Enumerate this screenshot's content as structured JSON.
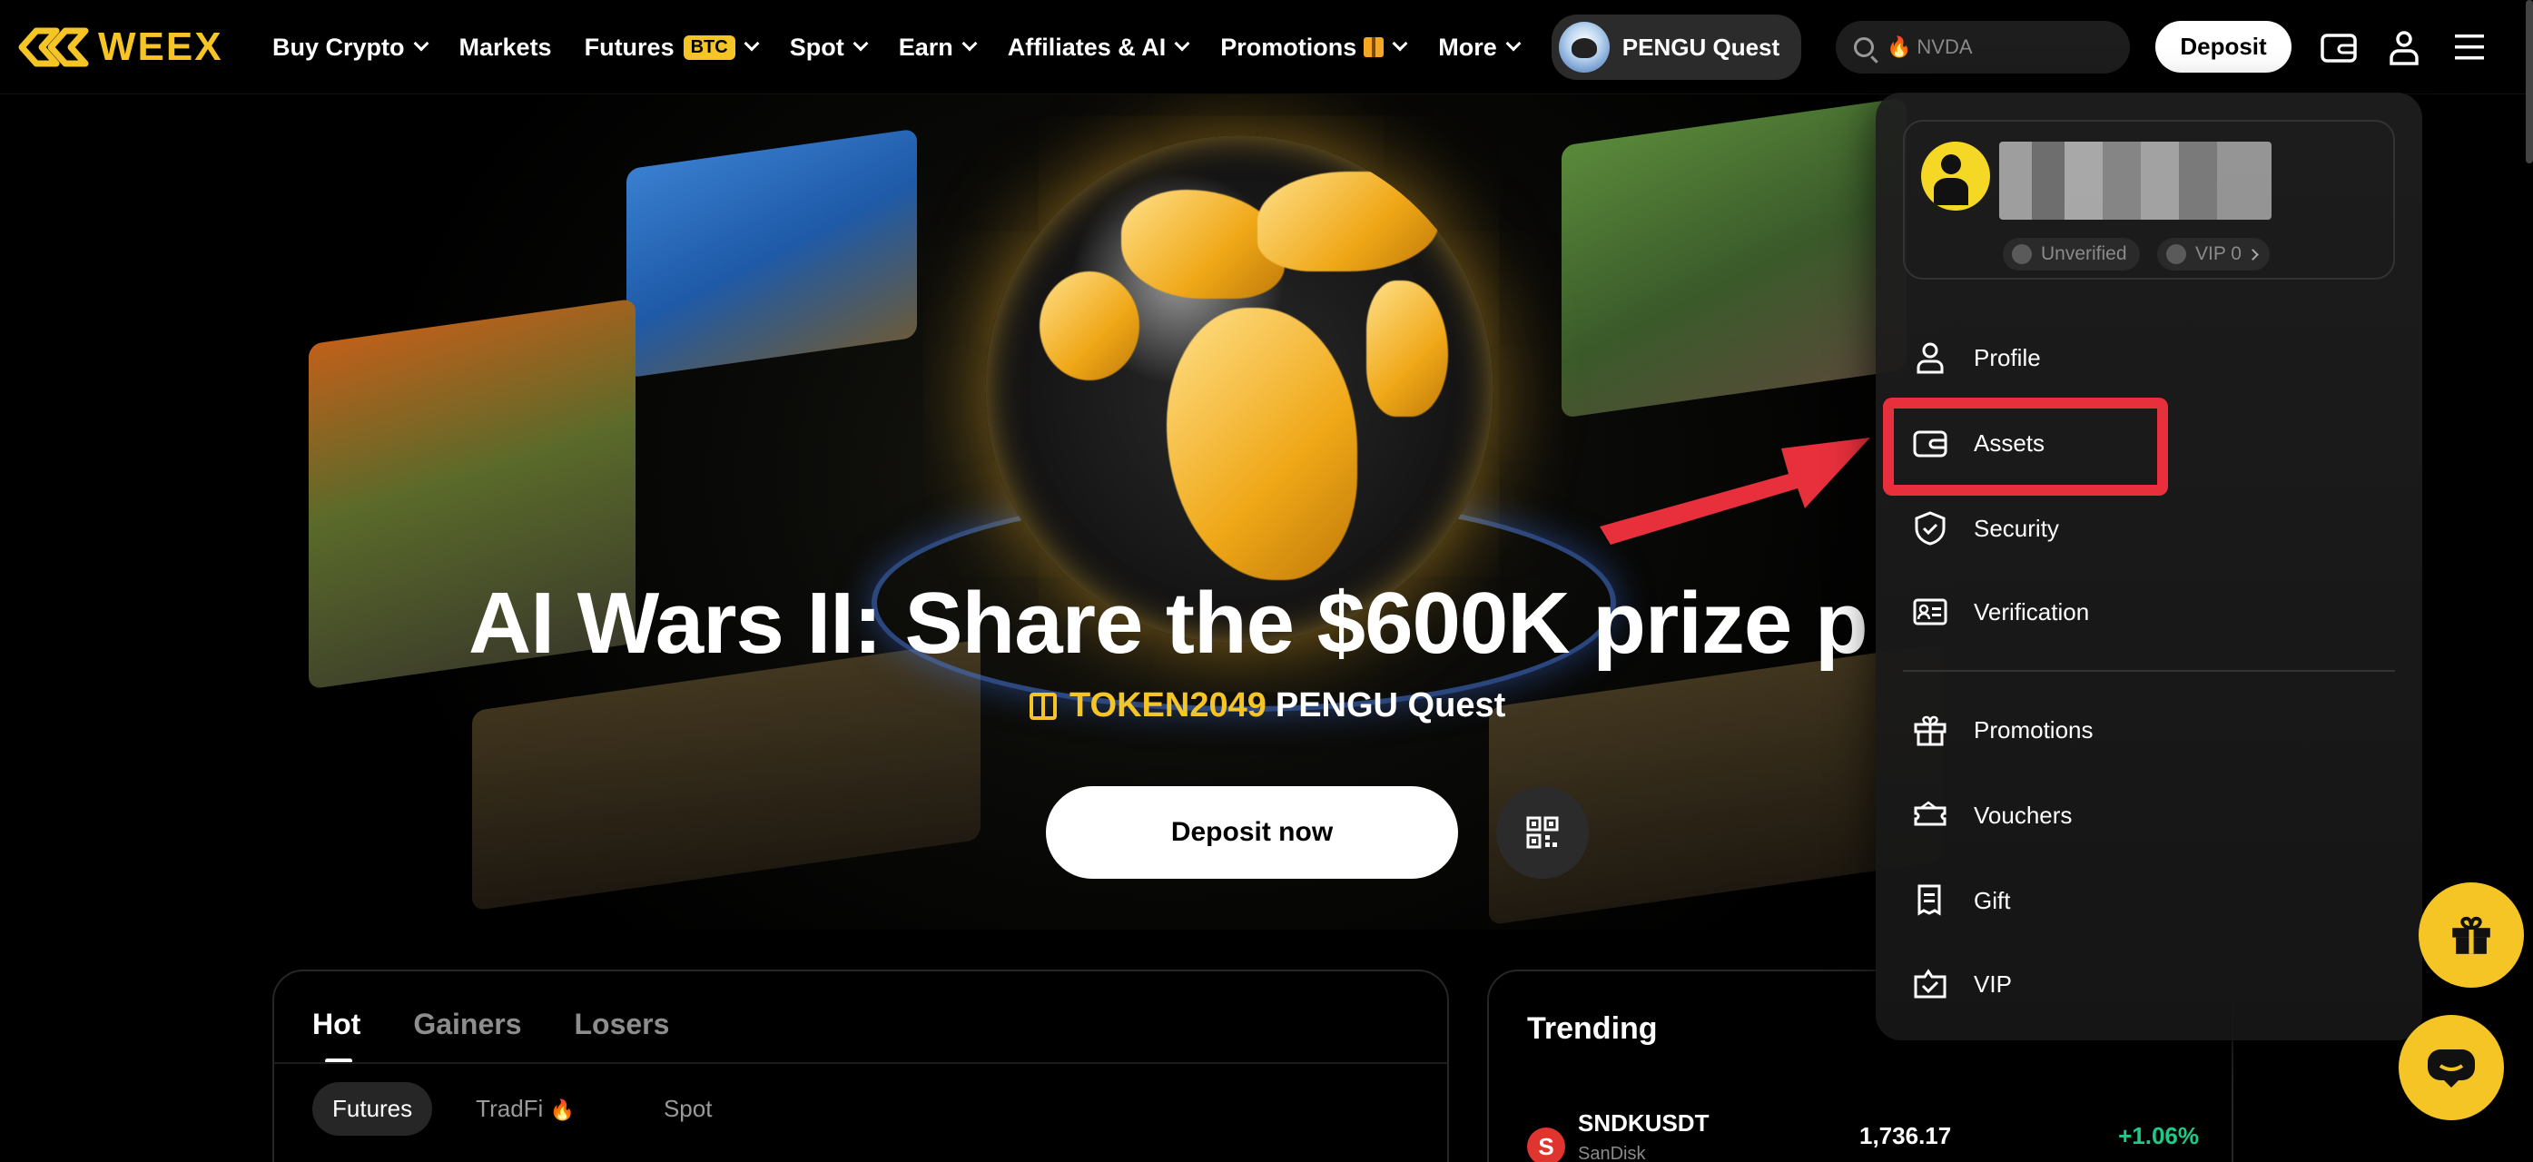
{
  "brand": {
    "name": "WEEX",
    "color": "#f5c526"
  },
  "nav": {
    "items": [
      {
        "label": "Buy Crypto",
        "dropdown": true
      },
      {
        "label": "Markets",
        "dropdown": false
      },
      {
        "label": "Futures",
        "badge": "BTC",
        "dropdown": true
      },
      {
        "label": "Spot",
        "dropdown": true
      },
      {
        "label": "Earn",
        "dropdown": true
      },
      {
        "label": "Affiliates & AI",
        "dropdown": true
      },
      {
        "label": "Promotions",
        "dropdown": true
      },
      {
        "label": "More",
        "dropdown": true
      }
    ],
    "quest": "PENGU Quest",
    "search_placeholder": "NVDA",
    "deposit": "Deposit",
    "icons": [
      "wallet-icon",
      "user-icon",
      "menu-icon"
    ]
  },
  "hero": {
    "title": "AI Wars II: Share the $600K prize p",
    "sub_highlight": "TOKEN2049",
    "sub_rest": "PENGU Quest",
    "cta": "Deposit now"
  },
  "markets": {
    "tabs": [
      "Hot",
      "Gainers",
      "Losers"
    ],
    "active_tab": "Hot",
    "subtabs": [
      "Futures",
      "TradFi",
      "Spot"
    ],
    "active_subtab": "Futures"
  },
  "trending": {
    "title": "Trending",
    "rows": [
      {
        "symbol": "SNDKUSDT",
        "name": "SanDisk",
        "price": "1,736.17",
        "change": "+1.06%",
        "icon_letter": "S"
      }
    ]
  },
  "account_menu": {
    "badges": {
      "verified": "Unverified",
      "vip": "VIP 0"
    },
    "items": [
      {
        "label": "Profile",
        "icon": "person-icon"
      },
      {
        "label": "Assets",
        "icon": "wallet-icon"
      },
      {
        "label": "Security",
        "icon": "shield-icon"
      },
      {
        "label": "Verification",
        "icon": "id-card-icon"
      },
      {
        "label": "Promotions",
        "icon": "gift-icon"
      },
      {
        "label": "Vouchers",
        "icon": "ticket-icon"
      },
      {
        "label": "Gift",
        "icon": "gift-card-icon"
      },
      {
        "label": "VIP",
        "icon": "crown-icon"
      }
    ],
    "highlighted": "Assets",
    "highlight_color": "#e8303d"
  }
}
